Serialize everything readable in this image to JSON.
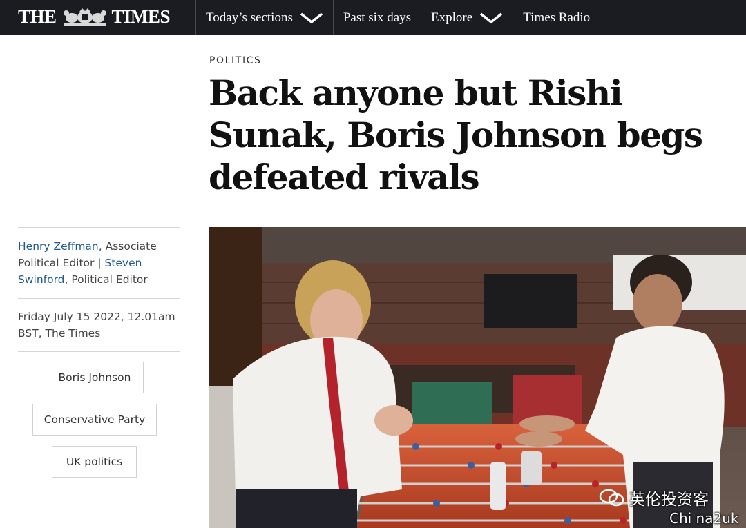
{
  "header": {
    "brand_left": "THE",
    "brand_right": "TIMES",
    "nav": [
      {
        "label": "Today’s sections",
        "has_dropdown": true
      },
      {
        "label": "Past six days",
        "has_dropdown": false
      },
      {
        "label": "Explore",
        "has_dropdown": true
      },
      {
        "label": "Times Radio",
        "has_dropdown": false
      }
    ]
  },
  "article": {
    "section": "POLITICS",
    "headline": "Back anyone but Rishi Sunak, Boris Johnson begs defeated rivals",
    "authors": [
      {
        "name": "Henry Zeffman",
        "role": ", Associate Political Editor"
      },
      {
        "name": "Steven Swinford",
        "role": ", Political Editor"
      }
    ],
    "author_separator": " | ",
    "date": "Friday July 15 2022, 12.01am BST, The Times",
    "tags": [
      "Boris Johnson",
      "Conservative Party",
      "UK politics"
    ]
  },
  "watermark": {
    "account": "英伦投资客",
    "handle": "Chi na2uk"
  },
  "colors": {
    "nav_background": "#1b1b22",
    "author_link": "#1f5a8e",
    "headline": "#111111"
  }
}
